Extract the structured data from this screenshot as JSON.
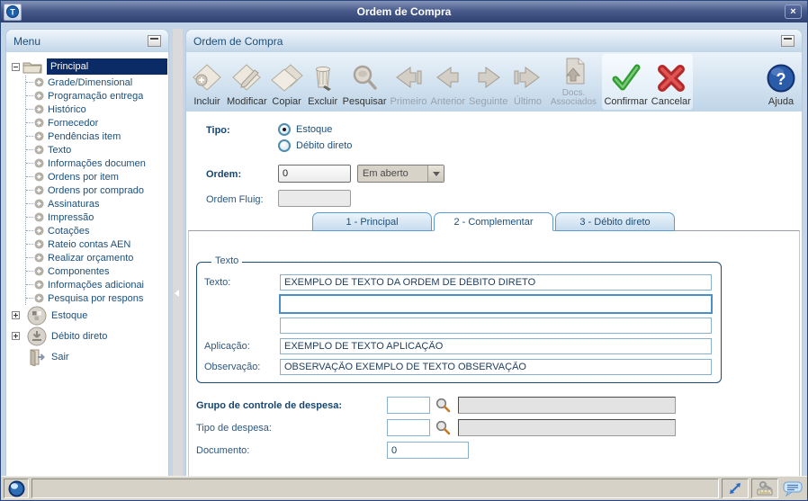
{
  "window": {
    "title": "Ordem de Compra",
    "close_label": "×",
    "logo_letter": "T"
  },
  "menu": {
    "panel_title": "Menu",
    "root": "Principal",
    "items": [
      "Grade/Dimensional",
      "Programação entrega",
      "Histórico",
      "Fornecedor",
      "Pendências item",
      "Texto",
      "Informações documen",
      "Ordens por item",
      "Ordens por comprado",
      "Assinaturas",
      "Impressão",
      "Cotações",
      "Rateio contas AEN",
      "Realizar orçamento",
      "Componentes",
      "Informações adicionai",
      "Pesquisa por respons"
    ],
    "groups": [
      {
        "label": "Estoque"
      },
      {
        "label": "Débito direto"
      }
    ],
    "exit": "Sair"
  },
  "main": {
    "panel_title": "Ordem de Compra",
    "toolbar": {
      "buttons": [
        {
          "label": "Incluir",
          "enabled": true
        },
        {
          "label": "Modificar",
          "enabled": true
        },
        {
          "label": "Copiar",
          "enabled": true
        },
        {
          "label": "Excluir",
          "enabled": true
        },
        {
          "label": "Pesquisar",
          "enabled": true
        },
        {
          "label": "Primeiro",
          "enabled": false
        },
        {
          "label": "Anterior",
          "enabled": false
        },
        {
          "label": "Seguinte",
          "enabled": false
        },
        {
          "label": "Último",
          "enabled": false
        },
        {
          "label": "Docs. Associados",
          "enabled": false
        },
        {
          "label": "Confirmar",
          "enabled": true
        },
        {
          "label": "Cancelar",
          "enabled": true
        },
        {
          "label": "Ajuda",
          "enabled": true
        }
      ]
    },
    "form": {
      "tipo_label": "Tipo:",
      "radio_estoque": "Estoque",
      "radio_debito": "Débito direto",
      "ordem_label": "Ordem:",
      "ordem_value": "0",
      "status_value": "Em aberto",
      "ordem_fluig_label": "Ordem Fluig:",
      "ordem_fluig_value": ""
    },
    "tabs": [
      {
        "label": "1 - Principal",
        "active": false
      },
      {
        "label": "2 - Complementar",
        "active": true
      },
      {
        "label": "3 - Débito direto",
        "active": false
      }
    ],
    "texto_group": {
      "legend": "Texto",
      "texto_label": "Texto:",
      "texto_value": "EXEMPLO DE TEXTO DA ORDEM DE DÉBITO DIRETO",
      "texto_line2": "",
      "texto_line3": "",
      "aplicacao_label": "Aplicação:",
      "aplicacao_value": "EXEMPLO DE TEXTO APLICAÇÃO",
      "observacao_label": "Observação:",
      "observacao_value": "OBSERVAÇÃO EXEMPLO DE TEXTO OBSERVAÇÃO"
    },
    "expense": {
      "grupo_label": "Grupo de controle de despesa:",
      "grupo_value": "",
      "grupo_desc": "",
      "tipo_label": "Tipo de despesa:",
      "tipo_value": "",
      "tipo_desc": "",
      "documento_label": "Documento:",
      "documento_value": "0"
    },
    "help_glyph": "?"
  },
  "colors": {
    "accent_navy": "#16325c",
    "header_text": "#1f4e79",
    "selected_bg": "#0a2b66",
    "confirm_green": "#2f9e2f",
    "cancel_red": "#c43c3c",
    "help_blue": "#2a5caa"
  }
}
